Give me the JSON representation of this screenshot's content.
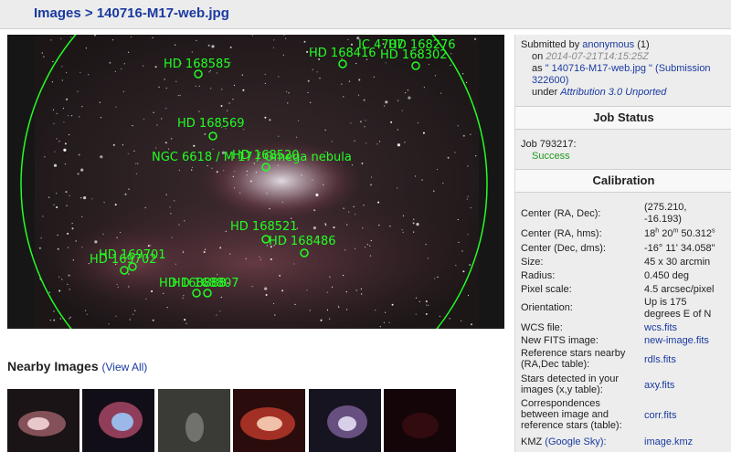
{
  "breadcrumb": {
    "root": "Images",
    "separator": ">",
    "current": "140716-M17-web.jpg"
  },
  "annotations": [
    {
      "name": "HD 168585"
    },
    {
      "name": "HD 168416"
    },
    {
      "name": "IC 4707"
    },
    {
      "name": "HD 168276"
    },
    {
      "name": "HD 168302"
    },
    {
      "name": "HD 168569"
    },
    {
      "name": "NGC 6618 / M 17 / Omega nebula"
    },
    {
      "name": "HD 168520"
    },
    {
      "name": "HD 168521"
    },
    {
      "name": "HD 168486"
    },
    {
      "name": "HD 169701"
    },
    {
      "name": "HD 169702"
    },
    {
      "name": "HD 168888"
    },
    {
      "name": "HD 168807"
    }
  ],
  "nearby": {
    "title": "Nearby Images",
    "view_all": "(View All)",
    "thumbnails": [
      "thumb-1",
      "thumb-2",
      "thumb-3",
      "thumb-4",
      "thumb-5",
      "thumb-6"
    ]
  },
  "submission": {
    "submitted_by_label": "Submitted by",
    "user": "anonymous",
    "count": "(1)",
    "on_label": "on",
    "date": "2014-07-21T14:15:25Z",
    "as_label": "as",
    "filename": "\" 140716-M17-web.jpg \"",
    "submission_link": "(Submission 322600)",
    "under_label": "under",
    "license": "Attribution 3.0 Unported"
  },
  "job": {
    "header": "Job Status",
    "label": "Job 793217:",
    "status": "Success"
  },
  "calibration": {
    "header": "Calibration",
    "center_label": "Center (RA, Dec):",
    "center_value_1": "(275.210,",
    "center_value_2": "-16.193)",
    "hms_label": "Center (RA, hms):",
    "hms_h": "18",
    "hms_h_unit": "h",
    "hms_m": "20",
    "hms_m_unit": "m",
    "hms_s": "50.312",
    "hms_s_unit": "s",
    "dms_label": "Center (Dec, dms):",
    "dms_value": "-16° 11' 34.058\"",
    "size_label": "Size:",
    "size_value": "45 x 30 arcmin",
    "radius_label": "Radius:",
    "radius_value": "0.450 deg",
    "pixscale_label": "Pixel scale:",
    "pixscale_value": "4.5 arcsec/pixel",
    "orient_label": "Orientation:",
    "orient_value_1": "Up is 175",
    "orient_value_2": "degrees E of N",
    "wcs_label": "WCS file:",
    "wcs_value": "wcs.fits",
    "fits_label": "New FITS image:",
    "fits_value": "new-image.fits",
    "rdls_label_1": "Reference stars nearby",
    "rdls_label_2": "(RA,Dec table):",
    "rdls_value": "rdls.fits",
    "axy_label_1": "Stars detected in your",
    "axy_label_2": "images (x,y table):",
    "axy_value": "axy.fits",
    "corr_label_1": "Correspondences",
    "corr_label_2": "between image and",
    "corr_label_3": "reference stars (table):",
    "corr_value": "corr.fits",
    "kmz_label": "KMZ",
    "kmz_sky": "(Google Sky):",
    "kmz_value": "image.kmz"
  },
  "colors": {
    "link": "#1a3aa0",
    "success": "#1e9a1e",
    "overlay": "#22ff22"
  }
}
